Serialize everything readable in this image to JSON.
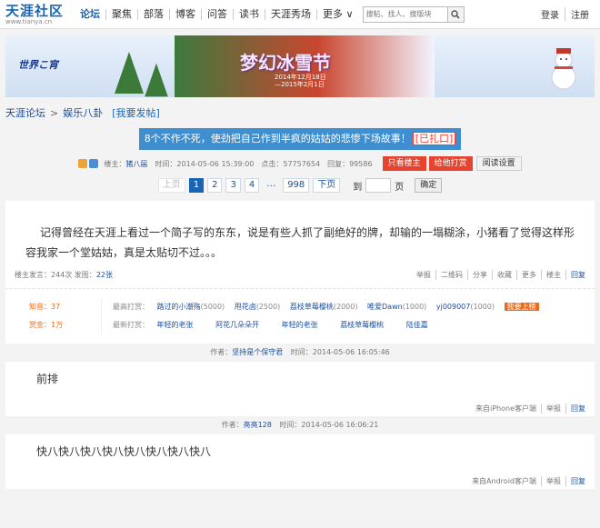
{
  "topnav": {
    "logo": "天涯社区",
    "logo_sub": "www.tianya.cn",
    "items": [
      "论坛",
      "聚焦",
      "部落",
      "博客",
      "问答",
      "读书",
      "天涯秀场",
      "更多 ∨"
    ],
    "search_placeholder": "搜帖、找人、搜版块",
    "login": "登录",
    "register": "注册"
  },
  "banner": {
    "left_text": "世界こ宵",
    "title": "梦幻冰雪节",
    "date_line1": "2014年12月18日",
    "date_line2": "—2015年2月1日"
  },
  "breadcrumb": {
    "root": "天涯论坛",
    "board": "娱乐八卦",
    "post_button": "[我要发帖]"
  },
  "thread": {
    "title": "8个不作不死，使劲把自己作到半疯的姑姑的悲惨下场故事！",
    "tag": "[已扎口]",
    "author_label": "楼主：",
    "author": "猪八届",
    "time": "时间：2014-05-06 15:39:00",
    "clicks": "点击：57757654",
    "replies": "回复：99586",
    "btn_only_op": "只看楼主",
    "btn_reward": "给他打赏",
    "btn_read_settings": "阅读设置"
  },
  "pager": {
    "prev": "上页",
    "pages": [
      "1",
      "2",
      "3",
      "4"
    ],
    "ellipsis": "…",
    "last": "998",
    "next": "下页",
    "goto_label": "到",
    "page_unit": "页",
    "confirm": "确定"
  },
  "main_post": {
    "body": "记得曾经在天涯上看过一个简子写的东东，说是有些人抓了副绝好的牌，却输的一塌糊涂，小猪看了觉得这样形容我家一个堂姑姑，真是太贴切不过。。。",
    "stats_prefix": "楼主发言：244次 发图：",
    "stats_images": "22张",
    "actions": [
      "举报",
      "二维码",
      "分享",
      "收藏",
      "更多",
      "楼主",
      "回复"
    ]
  },
  "rewards": {
    "zhiyu": "知音：37",
    "shangjin": "赏金：1万",
    "top_label": "最高打赏：",
    "top": [
      {
        "name": "路过的小潮殇",
        "amt": "(5000)"
      },
      {
        "name": "甩花卤",
        "amt": "(2500)"
      },
      {
        "name": "荔枝草莓樱桃",
        "amt": "(2000)"
      },
      {
        "name": "唯爱Dawn",
        "amt": "(1000)"
      },
      {
        "name": "yj009007",
        "amt": "(1000)"
      }
    ],
    "reward_btn": "我要上榜",
    "latest_label": "最新打赏：",
    "latest": [
      "年轻的老张",
      "阿花几朵朵开",
      "年轻的老张",
      "荔枝草莓樱桃",
      "陆佳嘉"
    ]
  },
  "replies": [
    {
      "author_label": "作者：",
      "author": "坚持是个保守君",
      "time": "时间：2014-05-06 16:05:46",
      "body": "前排",
      "source": "来自iPhone客户端",
      "report": "举报",
      "reply": "回复"
    },
    {
      "author_label": "作者：",
      "author": "亮亮128",
      "time": "时间：2014-05-06 16:06:21",
      "body": "快八快八快八快八快八快八快八快八",
      "source": "来自Android客户端",
      "report": "举报",
      "reply": "回复"
    }
  ]
}
